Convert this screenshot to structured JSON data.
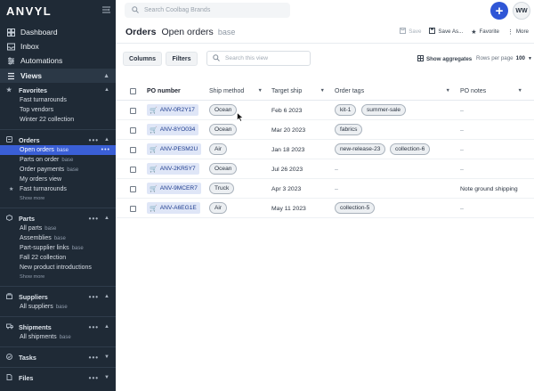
{
  "sidebar": {
    "logo": "ANVYL",
    "nav": [
      {
        "label": "Dashboard",
        "icon": "dashboard-icon"
      },
      {
        "label": "Inbox",
        "icon": "inbox-icon"
      },
      {
        "label": "Automations",
        "icon": "automations-icon"
      }
    ],
    "views_label": "Views",
    "favorites": {
      "title": "Favorites",
      "items": [
        "Fast turnarounds",
        "Top vendors",
        "Winter 22 collection"
      ]
    },
    "orders": {
      "title": "Orders",
      "items": [
        {
          "label": "Open orders",
          "base": "base"
        },
        {
          "label": "Parts on order",
          "base": "base"
        },
        {
          "label": "Order payments",
          "base": "base"
        },
        {
          "label": "My orders view",
          "base": ""
        },
        {
          "label": "Fast turnarounds",
          "base": ""
        }
      ],
      "show_more": "Show more"
    },
    "parts": {
      "title": "Parts",
      "items": [
        {
          "label": "All parts",
          "base": "base"
        },
        {
          "label": "Assemblies",
          "base": "base"
        },
        {
          "label": "Part-supplier links",
          "base": "base"
        },
        {
          "label": "Fall 22 collection",
          "base": ""
        },
        {
          "label": "New product introductions",
          "base": ""
        }
      ],
      "show_more": "Show more"
    },
    "suppliers": {
      "title": "Suppliers",
      "items": [
        {
          "label": "All suppliers",
          "base": "base"
        }
      ]
    },
    "shipments": {
      "title": "Shipments",
      "items": [
        {
          "label": "All shipments",
          "base": "base"
        }
      ]
    },
    "tasks": {
      "title": "Tasks"
    },
    "files": {
      "title": "Files"
    }
  },
  "topbar": {
    "search_placeholder": "Search Coolbag Brands",
    "add_label": "+",
    "avatar_initials": "WW"
  },
  "header": {
    "title": "Orders",
    "view": "Open orders",
    "base": "base",
    "actions": {
      "save": "Save",
      "save_as": "Save As...",
      "favorite": "Favorite",
      "more": "More"
    }
  },
  "toolbar": {
    "columns": "Columns",
    "filters": "Filters",
    "search_placeholder": "Search this view",
    "show_aggregates": "Show aggregates",
    "rows_per_page_label": "Rows per page",
    "rows_per_page_value": "100"
  },
  "table": {
    "headers": {
      "po_number": "PO number",
      "ship_method": "Ship method",
      "target_ship": "Target ship",
      "order_tags": "Order tags",
      "po_notes": "PO notes"
    },
    "rows": [
      {
        "po": "ANV-0R2Y17",
        "ship": "Ocean",
        "date": "Feb 6 2023",
        "tags": [
          "kit-1",
          "summer-sale"
        ],
        "note": "–"
      },
      {
        "po": "ANV-8YO034",
        "ship": "Ocean",
        "date": "Mar 20 2023",
        "tags": [
          "fabrics"
        ],
        "note": "–"
      },
      {
        "po": "ANV-PESM2U",
        "ship": "Air",
        "date": "Jan 18 2023",
        "tags": [
          "new-release-23",
          "collection-6"
        ],
        "note": "–"
      },
      {
        "po": "ANV-2KR5Y7",
        "ship": "Ocean",
        "date": "Jul 26 2023",
        "tags": [],
        "note": "–"
      },
      {
        "po": "ANV-9MCER7",
        "ship": "Truck",
        "date": "Apr 3 2023",
        "tags": [],
        "note": "Note ground shipping"
      },
      {
        "po": "ANV-A6EG1E",
        "ship": "Air",
        "date": "May 11 2023",
        "tags": [
          "collection-5"
        ],
        "note": "–"
      }
    ],
    "empty": "–"
  },
  "colors": {
    "sidebar_bg": "#1f2a36",
    "accent": "#2f56d6",
    "active_item": "#3a5fd6",
    "po_chip_bg": "#dfe6f7"
  }
}
